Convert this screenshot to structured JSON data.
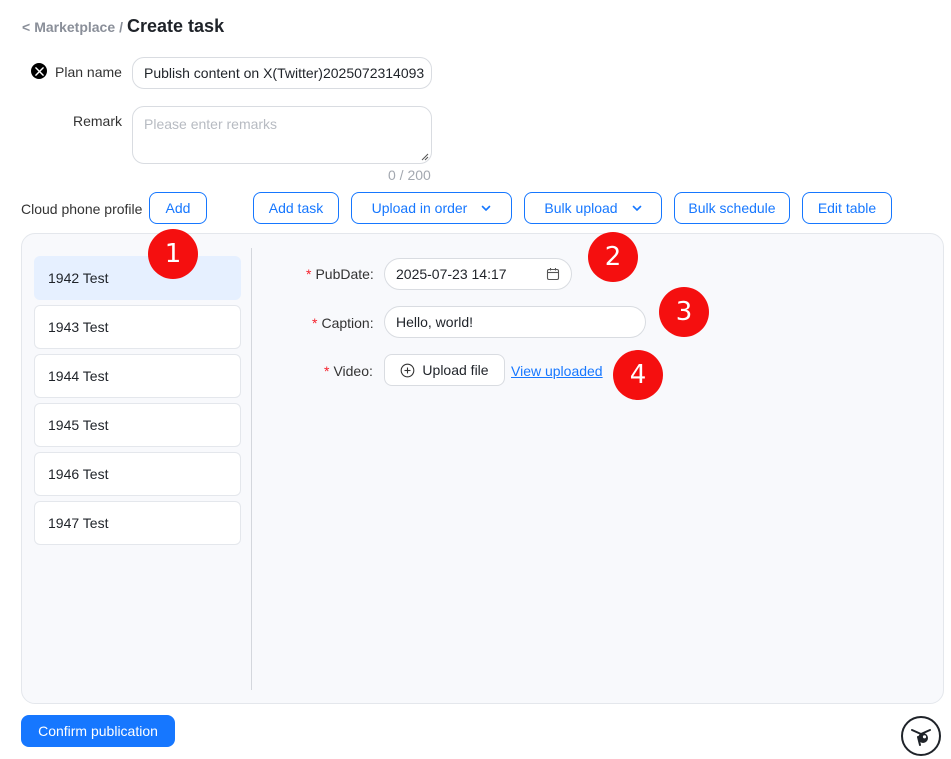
{
  "breadcrumb": {
    "back": "<",
    "parent": "Marketplace",
    "separator": "/",
    "title": "Create task"
  },
  "form": {
    "plan_name_label": "Plan name",
    "plan_name_value": "Publish content on X(Twitter)2025072314093",
    "remark_label": "Remark",
    "remark_placeholder": "Please enter remarks",
    "remark_counter": "0 / 200",
    "cloud_profile_label": "Cloud phone profile"
  },
  "toolbar": {
    "add": "Add",
    "add_task": "Add task",
    "upload_in_order": "Upload in order",
    "bulk_upload": "Bulk upload",
    "bulk_schedule": "Bulk schedule",
    "edit_table": "Edit table"
  },
  "profiles": [
    {
      "label": "1942 Test",
      "active": true
    },
    {
      "label": "1943 Test",
      "active": false
    },
    {
      "label": "1944 Test",
      "active": false
    },
    {
      "label": "1945 Test",
      "active": false
    },
    {
      "label": "1946 Test",
      "active": false
    },
    {
      "label": "1947 Test",
      "active": false
    }
  ],
  "task": {
    "required_mark": "*",
    "pubdate_label": "PubDate:",
    "pubdate_value": "2025-07-23 14:17",
    "caption_label": "Caption:",
    "caption_value": "Hello, world!",
    "video_label": "Video:",
    "upload_file": "Upload file",
    "view_uploaded": "View uploaded"
  },
  "markers": [
    "1",
    "2",
    "3",
    "4"
  ],
  "footer": {
    "confirm": "Confirm publication"
  },
  "icons": {
    "platform": "x-logo-icon",
    "calendar": "calendar-icon",
    "upload": "plus-circle-icon",
    "dropdown": "chevron-down-icon",
    "helper": "assistant-icon"
  },
  "colors": {
    "primary": "#1677ff",
    "required": "#f5222d",
    "marker": "#f50f0f",
    "active_item": "#e6f0ff"
  }
}
